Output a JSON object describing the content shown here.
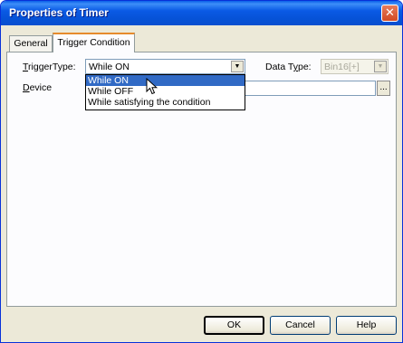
{
  "window": {
    "title": "Properties of Timer",
    "close_glyph": "✕"
  },
  "tabs": [
    {
      "label": "General",
      "active": false
    },
    {
      "label": "Trigger Condition",
      "active": true
    }
  ],
  "form": {
    "trigger_type": {
      "label_key": "T",
      "label_rest": "riggerType:",
      "value": "While ON",
      "options": [
        "While ON",
        "While OFF",
        "While satisfying the condition"
      ],
      "highlighted_index": 0
    },
    "data_type": {
      "label_pre": "Data T",
      "label_key": "y",
      "label_post": "pe:",
      "value": "Bin16[+]",
      "enabled": false
    },
    "device": {
      "label_key": "D",
      "label_rest": "evice",
      "value": "",
      "browse_label": "..."
    }
  },
  "buttons": {
    "ok": "OK",
    "cancel": "Cancel",
    "help": "Help"
  },
  "icons": {
    "dropdown_arrow": "▼",
    "cursor": "mouse-pointer-icon"
  },
  "colors": {
    "titlebar": "#0a5ae5",
    "selection": "#316ac5",
    "dialog_face": "#ece9d8"
  }
}
